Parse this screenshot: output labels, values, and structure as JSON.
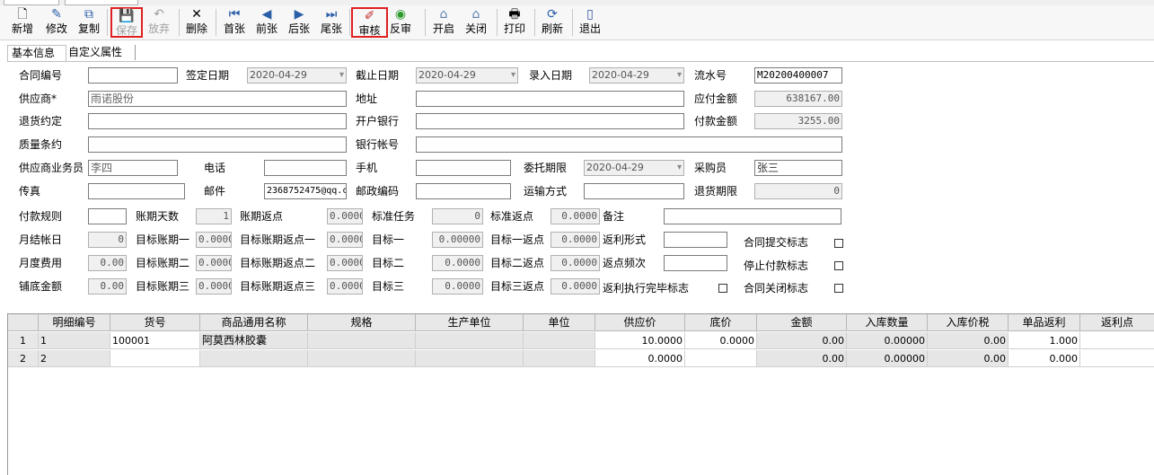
{
  "toolbar": {
    "buttons": [
      {
        "label": "新增"
      },
      {
        "label": "修改"
      },
      {
        "label": "复制"
      },
      {
        "label": "保存"
      },
      {
        "label": "放弃"
      },
      {
        "label": "删除"
      },
      {
        "label": "首张"
      },
      {
        "label": "前张"
      },
      {
        "label": "后张"
      },
      {
        "label": "尾张"
      },
      {
        "label": "审核"
      },
      {
        "label": "反审"
      },
      {
        "label": "开启"
      },
      {
        "label": "关闭"
      },
      {
        "label": "打印"
      },
      {
        "label": "刷新"
      },
      {
        "label": "退出"
      }
    ]
  },
  "tabs": [
    "基本信息",
    "自定义属性"
  ],
  "form": {
    "contract_no": {
      "label": "合同编号",
      "value": ""
    },
    "sign_date": {
      "label": "签定日期",
      "value": "2020-04-29"
    },
    "end_date": {
      "label": "截止日期",
      "value": "2020-04-29"
    },
    "entry_date": {
      "label": "录入日期",
      "value": "2020-04-29"
    },
    "serial_no": {
      "label": "流水号",
      "value": "M20200400007"
    },
    "supplier": {
      "label": "供应商*",
      "value": "雨诺股份"
    },
    "address": {
      "label": "地址",
      "value": ""
    },
    "payable": {
      "label": "应付金额",
      "value": "638167.00"
    },
    "return_terms": {
      "label": "退货约定",
      "value": ""
    },
    "bank": {
      "label": "开户银行",
      "value": ""
    },
    "paid": {
      "label": "付款金额",
      "value": "3255.00"
    },
    "quality_terms": {
      "label": "质量条约",
      "value": ""
    },
    "bank_account": {
      "label": "银行帐号",
      "value": ""
    },
    "sales_rep": {
      "label": "供应商业务员",
      "value": "李四"
    },
    "phone": {
      "label": "电话",
      "value": ""
    },
    "mobile": {
      "label": "手机",
      "value": ""
    },
    "entrust_date": {
      "label": "委托期限",
      "value": "2020-04-29"
    },
    "buyer": {
      "label": "采购员",
      "value": "张三"
    },
    "fax": {
      "label": "传真",
      "value": ""
    },
    "email": {
      "label": "邮件",
      "value": "2368752475@qq.c"
    },
    "postcode": {
      "label": "邮政编码",
      "value": ""
    },
    "shipping": {
      "label": "运输方式",
      "value": ""
    },
    "return_period": {
      "label": "退货期限",
      "value": "0"
    },
    "pay_rule": {
      "label": "付款规则",
      "value": ""
    },
    "credit_days": {
      "label": "账期天数",
      "value": "1"
    },
    "credit_rebate": {
      "label": "账期返点",
      "value": "0.0000"
    },
    "std_task": {
      "label": "标准任务",
      "value": "0"
    },
    "std_rebate": {
      "label": "标准返点",
      "value": "0.0000"
    },
    "remark": {
      "label": "备注",
      "value": ""
    },
    "month_day": {
      "label": "月结帐日",
      "value": "0"
    },
    "target_period1": {
      "label": "目标账期一",
      "value": "0.0000"
    },
    "target_period_rebate1": {
      "label": "目标账期返点一",
      "value": "0.0000"
    },
    "target1": {
      "label": "目标一",
      "value": "0.00000"
    },
    "target1_rebate": {
      "label": "目标一返点",
      "value": "0.0000"
    },
    "rebate_form": {
      "label": "返利形式",
      "value": ""
    },
    "contract_submit": {
      "label": "合同提交标志"
    },
    "monthly_fee": {
      "label": "月度费用",
      "value": "0.00"
    },
    "target_period2": {
      "label": "目标账期二",
      "value": "0.0000"
    },
    "target_period_rebate2": {
      "label": "目标账期返点二",
      "value": "0.0000"
    },
    "target2": {
      "label": "目标二",
      "value": "0.0000"
    },
    "target2_rebate": {
      "label": "目标二返点",
      "value": "0.0000"
    },
    "rebate_freq": {
      "label": "返点频次",
      "value": ""
    },
    "stop_pay": {
      "label": "停止付款标志"
    },
    "base_amount": {
      "label": "铺底金额",
      "value": "0.00"
    },
    "target_period3": {
      "label": "目标账期三",
      "value": "0.0000"
    },
    "target_period_rebate3": {
      "label": "目标账期返点三",
      "value": "0.0000"
    },
    "target3": {
      "label": "目标三",
      "value": "0.0000"
    },
    "target3_rebate": {
      "label": "目标三返点",
      "value": "0.0000"
    },
    "rebate_done": {
      "label": "返利执行完毕标志"
    },
    "contract_close": {
      "label": "合同关闭标志"
    }
  },
  "grid": {
    "columns": [
      "明细编号",
      "货号",
      "商品通用名称",
      "规格",
      "生产单位",
      "单位",
      "供应价",
      "底价",
      "金额",
      "入库数量",
      "入库价税",
      "单品返利",
      "返利点"
    ],
    "rows": [
      {
        "num": "1",
        "cells": [
          "1",
          "100001",
          "阿莫西林胶囊",
          "",
          "",
          "",
          "10.0000",
          "0.0000",
          "0.00",
          "0.00000",
          "0.00",
          "1.000",
          ""
        ]
      },
      {
        "num": "2",
        "cells": [
          "2",
          "",
          "",
          "",
          "",
          "",
          "0.0000",
          "",
          "0.00",
          "0.00000",
          "0.00",
          "0.000",
          ""
        ]
      }
    ]
  }
}
